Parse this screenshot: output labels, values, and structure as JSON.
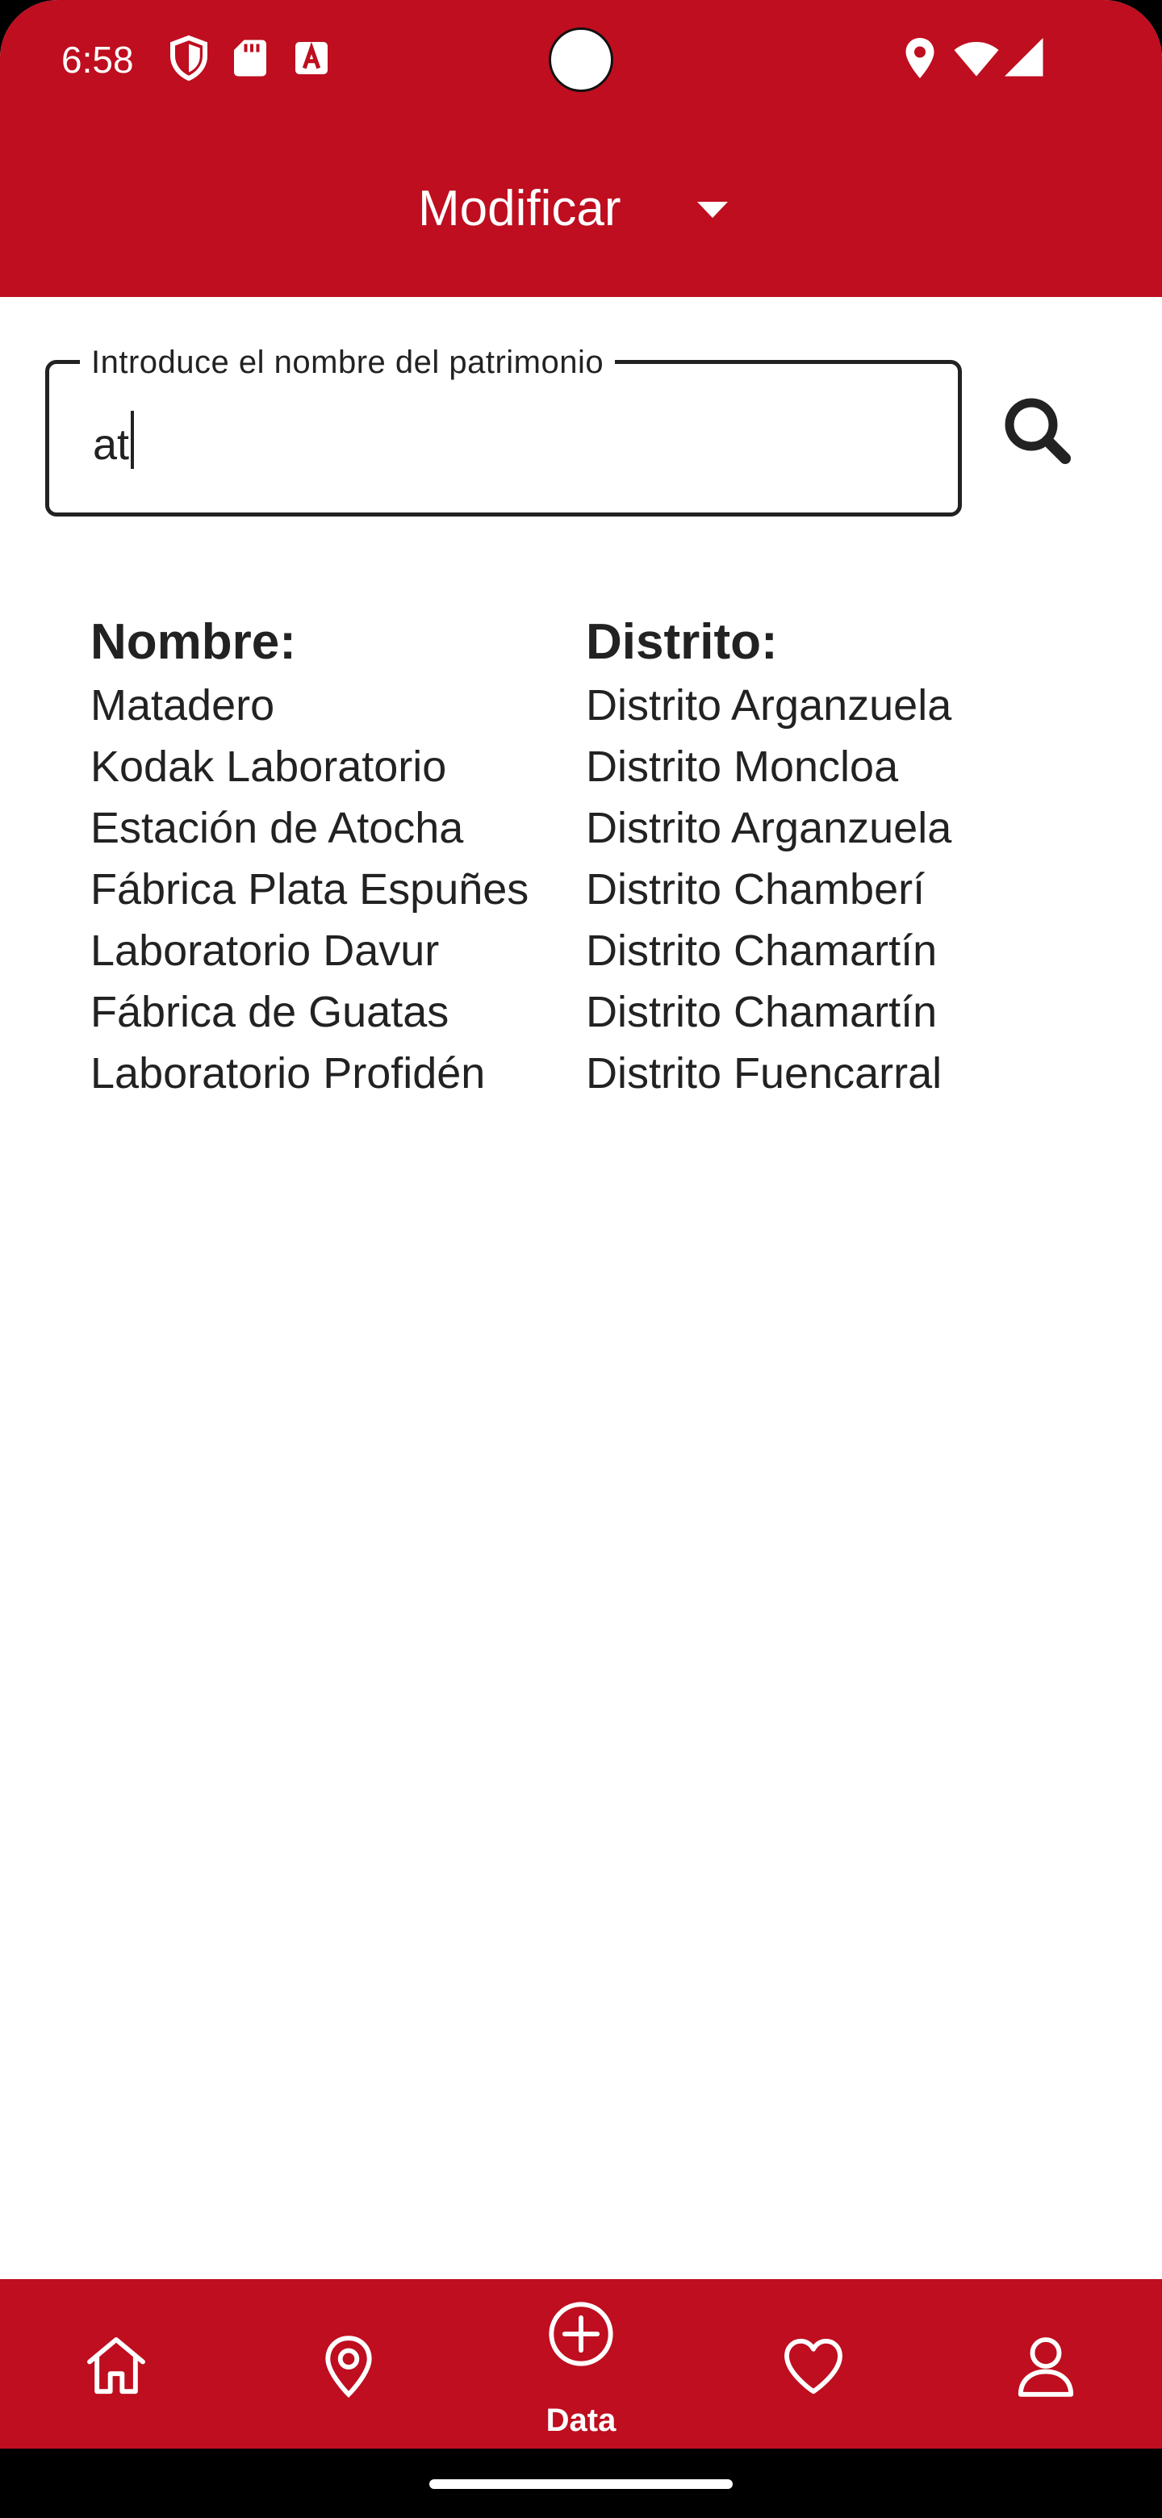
{
  "status_bar": {
    "time": "6:58",
    "left_icons": [
      "shield-icon",
      "sd-card-icon",
      "text-a-icon"
    ],
    "right_icons": [
      "location-icon",
      "wifi-icon",
      "signal-icon"
    ]
  },
  "app_bar": {
    "dropdown_value": "Modificar",
    "dropdown_icon": "dropdown-arrow-icon"
  },
  "search": {
    "label": "Introduce el nombre del patrimonio",
    "value": "at",
    "button_icon": "search-icon"
  },
  "results": {
    "headers": {
      "name": "Nombre:",
      "district": "Distrito:"
    },
    "rows": [
      {
        "name": "Matadero",
        "district": "Distrito Arganzuela"
      },
      {
        "name": "Kodak Laboratorio",
        "district": "Distrito Moncloa"
      },
      {
        "name": "Estación de Atocha",
        "district": "Distrito Arganzuela"
      },
      {
        "name": "Fábrica Plata Espuñes",
        "district": "Distrito Chamberí"
      },
      {
        "name": "Laboratorio Davur",
        "district": "Distrito Chamartín"
      },
      {
        "name": "Fábrica de Guatas",
        "district": "Distrito Chamartín"
      },
      {
        "name": "Laboratorio Profidén",
        "district": "Distrito Fuencarral"
      }
    ]
  },
  "bottom_nav": {
    "items": [
      {
        "icon": "home-icon",
        "label": ""
      },
      {
        "icon": "map-pin-icon",
        "label": ""
      },
      {
        "icon": "add-circle-icon",
        "label": "Data",
        "active": true
      },
      {
        "icon": "heart-icon",
        "label": ""
      },
      {
        "icon": "user-icon",
        "label": ""
      }
    ]
  },
  "colors": {
    "primary": "#be0e1f",
    "text": "#222222",
    "on_primary": "#ffffff"
  }
}
